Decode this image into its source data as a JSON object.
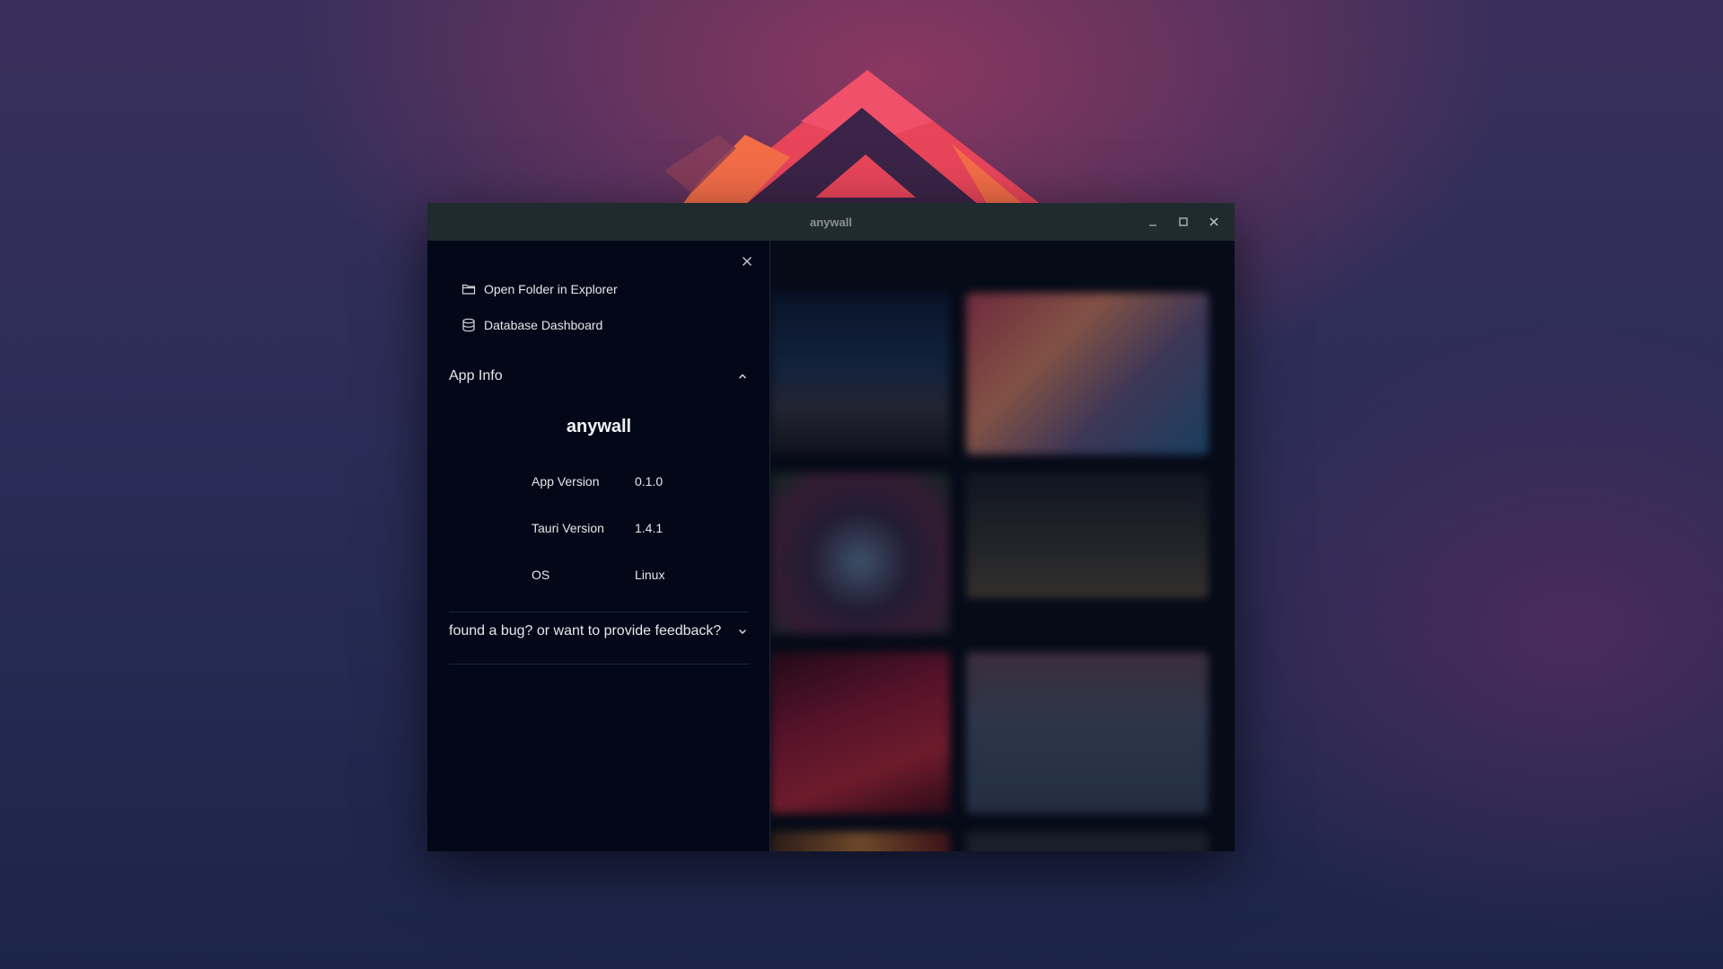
{
  "window": {
    "title": "anywall"
  },
  "sidebar": {
    "menu": [
      {
        "label": "Open Folder in Explorer",
        "icon": "folder-icon"
      },
      {
        "label": "Database Dashboard",
        "icon": "database-icon"
      }
    ],
    "app_info": {
      "header": "App Info",
      "app_name": "anywall",
      "rows": [
        {
          "key": "App Version",
          "value": "0.1.0"
        },
        {
          "key": "Tauri Version",
          "value": "1.4.1"
        },
        {
          "key": "OS",
          "value": "Linux"
        }
      ]
    },
    "feedback": {
      "header": "found a bug? or want to provide feedback?"
    }
  },
  "colors": {
    "sidebar_bg": "#020817",
    "titlebar_bg": "#1f2b2e",
    "text": "#e6e8ec"
  }
}
